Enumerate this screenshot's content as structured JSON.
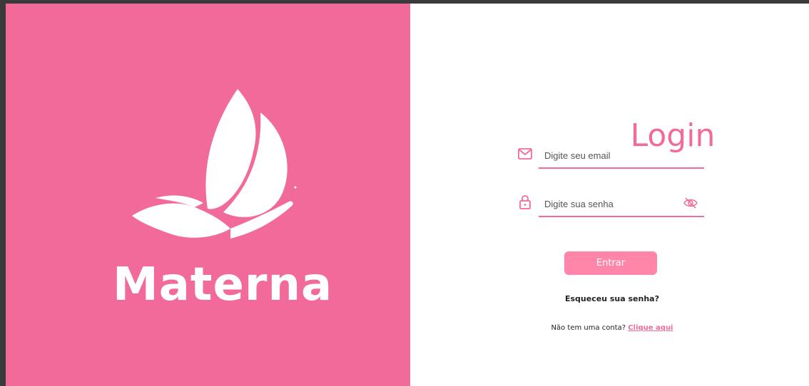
{
  "brand": {
    "name": "Materna",
    "panel_color": "#f26a9a",
    "logo_icon": "butterfly-icon"
  },
  "login": {
    "title": "Login",
    "email": {
      "icon": "mail-icon",
      "placeholder": "Digite seu email",
      "value": ""
    },
    "password": {
      "icon": "lock-icon",
      "placeholder": "Digite sua senha",
      "value": "",
      "toggle_icon": "eye-off-icon"
    },
    "submit_label": "Entrar",
    "forgot_label": "Esqueceu sua senha?",
    "signup_prompt": "Não tem uma conta?",
    "signup_link": "Clique aqui",
    "accent_color": "#f26a9a",
    "button_color": "#ff86a8"
  }
}
